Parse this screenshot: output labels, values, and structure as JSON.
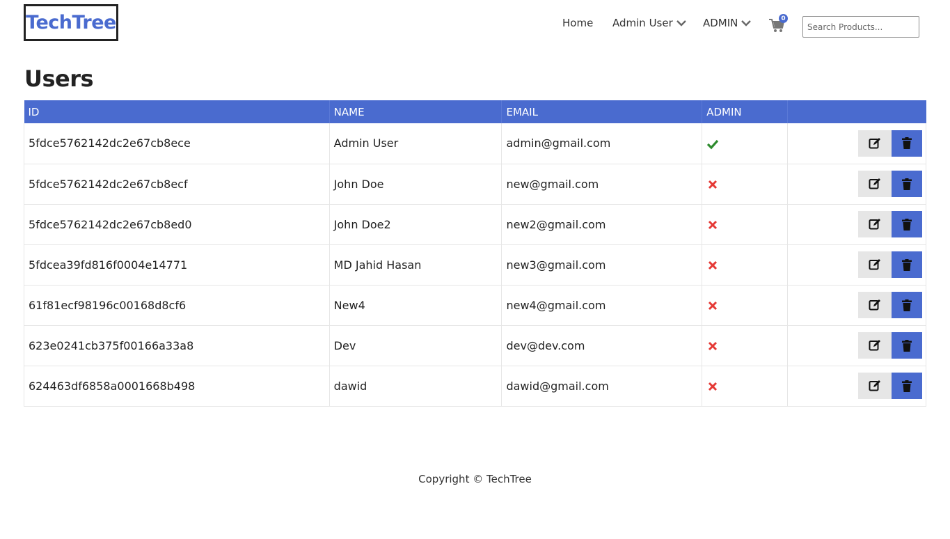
{
  "header": {
    "brand": "TechTree",
    "nav": {
      "home": "Home",
      "user_menu": "Admin User",
      "admin_menu": "ADMIN"
    },
    "cart_count": "0",
    "search_placeholder": "Search Products..."
  },
  "page": {
    "title": "Users"
  },
  "table": {
    "headers": [
      "ID",
      "NAME",
      "EMAIL",
      "ADMIN",
      ""
    ],
    "rows": [
      {
        "id": "5fdce5762142dc2e67cb8ece",
        "name": "Admin User",
        "email": "admin@gmail.com",
        "admin": true
      },
      {
        "id": "5fdce5762142dc2e67cb8ecf",
        "name": "John Doe",
        "email": "new@gmail.com",
        "admin": false
      },
      {
        "id": "5fdce5762142dc2e67cb8ed0",
        "name": "John Doe2",
        "email": "new2@gmail.com",
        "admin": false
      },
      {
        "id": "5fdcea39fd816f0004e14771",
        "name": "MD Jahid Hasan",
        "email": "new3@gmail.com",
        "admin": false
      },
      {
        "id": "61f81ecf98196c00168d8cf6",
        "name": "New4",
        "email": "new4@gmail.com",
        "admin": false
      },
      {
        "id": "623e0241cb375f00166a33a8",
        "name": "Dev",
        "email": "dev@dev.com",
        "admin": false
      },
      {
        "id": "624463df6858a0001668b498",
        "name": "dawid",
        "email": "dawid@gmail.com",
        "admin": false
      }
    ]
  },
  "footer": {
    "copyright": "Copyright © TechTree"
  },
  "colors": {
    "accent": "#4a6bcf",
    "admin_true": "#2e8b2e",
    "admin_false": "#e53935",
    "edit_bg": "#e6e6e6"
  },
  "icons": {
    "edit": "edit-icon",
    "delete": "trash-icon",
    "admin_true": "check-icon",
    "admin_false": "times-icon",
    "cart": "cart-icon",
    "dropdown": "chevron-down-icon"
  }
}
